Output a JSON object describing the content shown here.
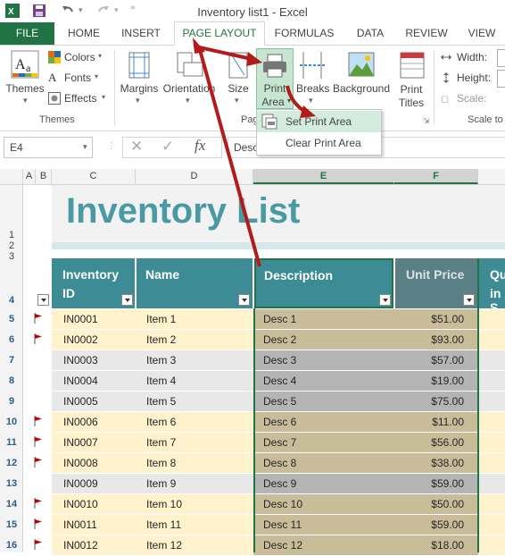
{
  "window": {
    "title": "Inventory list1 - Excel"
  },
  "tabs": [
    "FILE",
    "HOME",
    "INSERT",
    "PAGE LAYOUT",
    "FORMULAS",
    "DATA",
    "REVIEW",
    "VIEW"
  ],
  "ribbon": {
    "themes": {
      "themes_label": "Themes",
      "colors": "Colors",
      "fonts": "Fonts",
      "effects": "Effects",
      "group": "Themes"
    },
    "page_setup": {
      "margins": "Margins",
      "orientation": "Orientation",
      "size": "Size",
      "print_area_1": "Print",
      "print_area_2": "Area",
      "breaks": "Breaks",
      "background": "Background",
      "print_titles_1": "Print",
      "print_titles_2": "Titles",
      "group": "Pag"
    },
    "scale": {
      "width": "Width:",
      "height": "Height:",
      "scale": "Scale:",
      "group": "Scale to"
    }
  },
  "dropdown": {
    "set_print_area": "Set Print Area",
    "clear_print_area": "Clear Print Area"
  },
  "formula_bar": {
    "name_box": "E4",
    "content": "Desc",
    "fx": "fx"
  },
  "columns": [
    "A",
    "B",
    "C",
    "D",
    "E",
    "F"
  ],
  "sheet": {
    "title": "Inventory List",
    "headers": {
      "id_1": "Inventory",
      "id_2": "ID",
      "name": "Name",
      "description": "Description",
      "unit_price": "Unit Price",
      "partial_1": "Qu",
      "partial_2": "in S"
    },
    "row_numbers_top": [
      "1",
      "2",
      "3",
      "4"
    ],
    "rows": [
      {
        "num": "5",
        "flag": true,
        "id": "IN0001",
        "name": "Item 1",
        "desc": "Desc 1",
        "price": "$51.00"
      },
      {
        "num": "6",
        "flag": true,
        "id": "IN0002",
        "name": "Item 2",
        "desc": "Desc 2",
        "price": "$93.00"
      },
      {
        "num": "7",
        "flag": false,
        "id": "IN0003",
        "name": "Item 3",
        "desc": "Desc 3",
        "price": "$57.00"
      },
      {
        "num": "8",
        "flag": false,
        "id": "IN0004",
        "name": "Item 4",
        "desc": "Desc 4",
        "price": "$19.00"
      },
      {
        "num": "9",
        "flag": false,
        "id": "IN0005",
        "name": "Item 5",
        "desc": "Desc 5",
        "price": "$75.00"
      },
      {
        "num": "10",
        "flag": true,
        "id": "IN0006",
        "name": "Item 6",
        "desc": "Desc 6",
        "price": "$11.00"
      },
      {
        "num": "11",
        "flag": true,
        "id": "IN0007",
        "name": "Item 7",
        "desc": "Desc 7",
        "price": "$56.00"
      },
      {
        "num": "12",
        "flag": true,
        "id": "IN0008",
        "name": "Item 8",
        "desc": "Desc 8",
        "price": "$38.00"
      },
      {
        "num": "13",
        "flag": false,
        "id": "IN0009",
        "name": "Item 9",
        "desc": "Desc 9",
        "price": "$59.00"
      },
      {
        "num": "14",
        "flag": true,
        "id": "IN0010",
        "name": "Item 10",
        "desc": "Desc 10",
        "price": "$50.00"
      },
      {
        "num": "15",
        "flag": true,
        "id": "IN0011",
        "name": "Item 11",
        "desc": "Desc 11",
        "price": "$59.00"
      },
      {
        "num": "16",
        "flag": true,
        "id": "IN0012",
        "name": "Item 12",
        "desc": "Desc 12",
        "price": "$18.00"
      }
    ]
  },
  "colors": {
    "excel_green": "#217346",
    "header_teal": "#3d8b95",
    "selected_col": "#5a7f84",
    "row_yellow": "#fff2cc",
    "row_gray": "#e8e8e8",
    "sel_yellow": "#c9bd99",
    "sel_gray": "#b4b4b4",
    "arrow_red": "#b31b1b",
    "flag_red": "#c00000"
  }
}
